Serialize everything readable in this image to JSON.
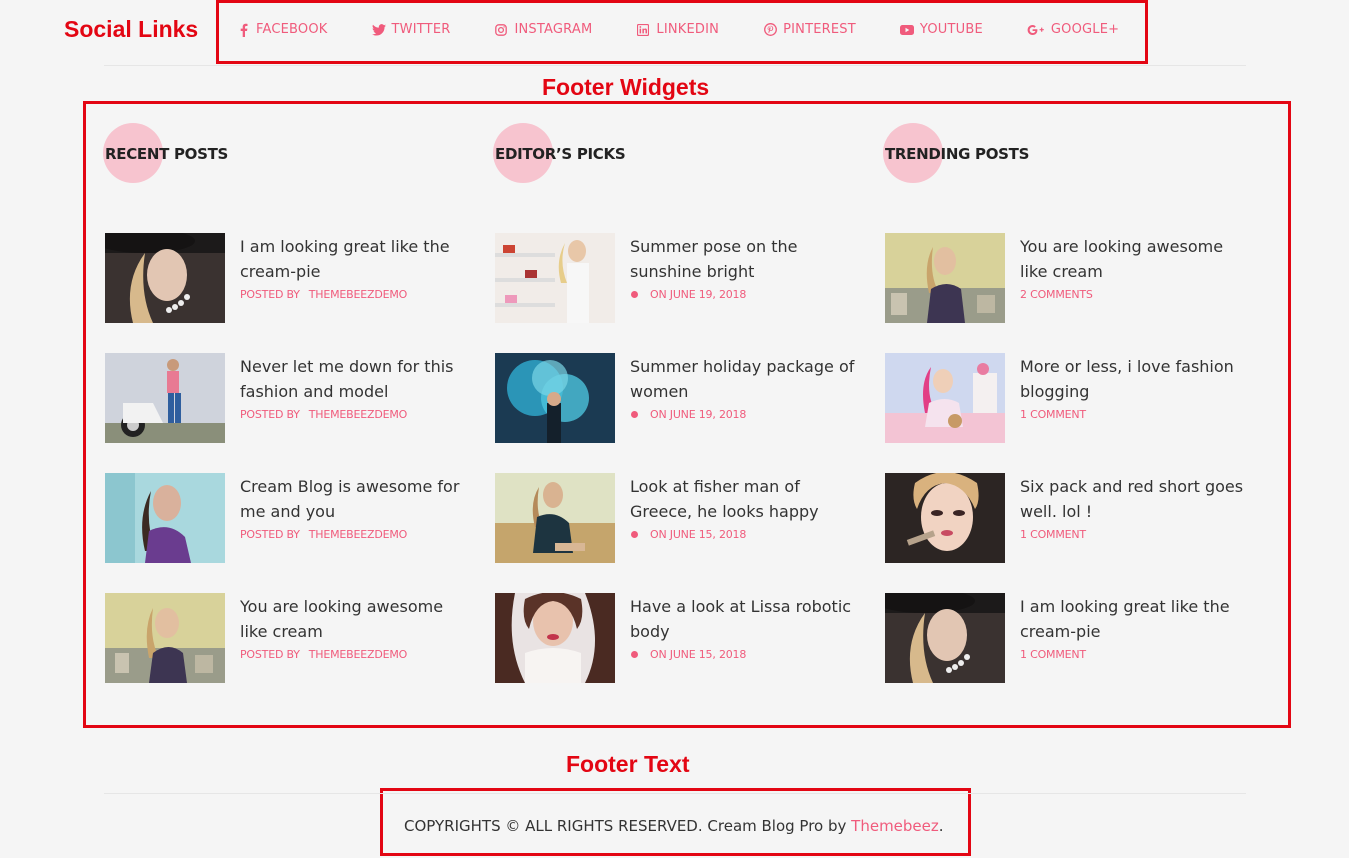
{
  "annotations": {
    "social_links": "Social Links",
    "footer_widgets": "Footer Widgets",
    "footer_text": "Footer Text"
  },
  "social": [
    {
      "label": "FACEBOOK",
      "icon": "facebook-icon"
    },
    {
      "label": "TWITTER",
      "icon": "twitter-icon"
    },
    {
      "label": "INSTAGRAM",
      "icon": "instagram-icon"
    },
    {
      "label": "LINKEDIN",
      "icon": "linkedin-icon"
    },
    {
      "label": "PINTEREST",
      "icon": "pinterest-icon"
    },
    {
      "label": "YOUTUBE",
      "icon": "youtube-icon"
    },
    {
      "label": "GOOGLE+",
      "icon": "google-plus-icon"
    }
  ],
  "widgets": {
    "recent": {
      "title": "RECENT POSTS",
      "posts": [
        {
          "title": "I am looking great like the cream-pie",
          "meta_prefix": "POSTED BY",
          "meta": "THEMEBEEZDEMO"
        },
        {
          "title": "Never let me down for this fashion and model",
          "meta_prefix": "POSTED BY",
          "meta": "THEMEBEEZDEMO"
        },
        {
          "title": "Cream Blog is awesome for me and you",
          "meta_prefix": "POSTED BY",
          "meta": "THEMEBEEZDEMO"
        },
        {
          "title": "You are looking awesome like cream",
          "meta_prefix": "POSTED BY",
          "meta": "THEMEBEEZDEMO"
        }
      ]
    },
    "editors": {
      "title": "EDITOR’S PICKS",
      "posts": [
        {
          "title": "Summer pose on the sunshine bright",
          "meta": "ON JUNE 19, 2018"
        },
        {
          "title": "Summer holiday package of women",
          "meta": "ON JUNE 19, 2018"
        },
        {
          "title": "Look at fisher man of Greece, he looks happy",
          "meta": "ON JUNE 15, 2018"
        },
        {
          "title": "Have a look at Lissa robotic body",
          "meta": "ON JUNE 15, 2018"
        }
      ]
    },
    "trending": {
      "title": "TRENDING POSTS",
      "posts": [
        {
          "title": "You are looking awesome like cream",
          "meta": "2 COMMENTS"
        },
        {
          "title": "More or less, i love fashion blogging",
          "meta": "1 COMMENT"
        },
        {
          "title": "Six pack and red short goes well. lol !",
          "meta": "1 COMMENT"
        },
        {
          "title": "I am looking great like the cream-pie",
          "meta": "1 COMMENT"
        }
      ]
    }
  },
  "footer": {
    "copyright_text": "COPYRIGHTS © ALL RIGHTS RESERVED. Cream Blog Pro by ",
    "link_text": "Themebeez",
    "suffix": "."
  },
  "colors": {
    "accent": "#f05b7c",
    "annotation_red": "#e30613",
    "heading_dot": "#f7c4cf",
    "background": "#f5f5f5"
  }
}
